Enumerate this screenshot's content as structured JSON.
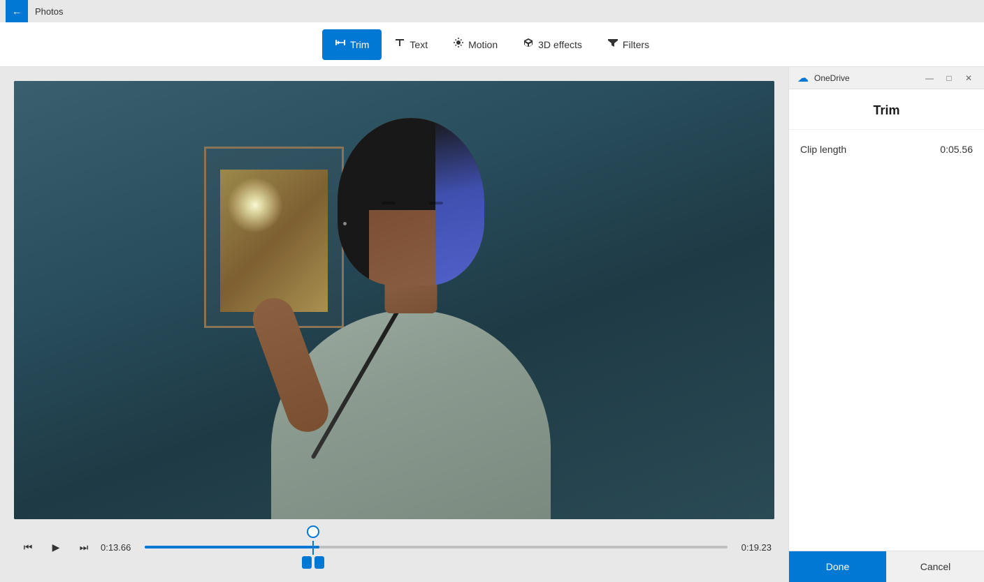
{
  "titleBar": {
    "appName": "Photos",
    "backIcon": "←"
  },
  "toolbar": {
    "buttons": [
      {
        "id": "trim",
        "label": "Trim",
        "active": true,
        "icon": "trim"
      },
      {
        "id": "text",
        "label": "Text",
        "active": false,
        "icon": "text"
      },
      {
        "id": "motion",
        "label": "Motion",
        "active": false,
        "icon": "motion"
      },
      {
        "id": "3deffects",
        "label": "3D effects",
        "active": false,
        "icon": "3d"
      },
      {
        "id": "filters",
        "label": "Filters",
        "active": false,
        "icon": "filters"
      }
    ]
  },
  "controls": {
    "rewindIcon": "⏮",
    "playIcon": "▶",
    "fastForwardIcon": "⏭",
    "currentTime": "0:13.66",
    "endTime": "0:19.23"
  },
  "rightPanel": {
    "onedrive": {
      "appName": "OneDrive",
      "minimizeIcon": "—",
      "maximizeIcon": "□",
      "closeIcon": "✕"
    },
    "title": "Trim",
    "clipLengthLabel": "Clip length",
    "clipLengthValue": "0:05.56",
    "doneLabel": "Done",
    "cancelLabel": "Cancel"
  }
}
